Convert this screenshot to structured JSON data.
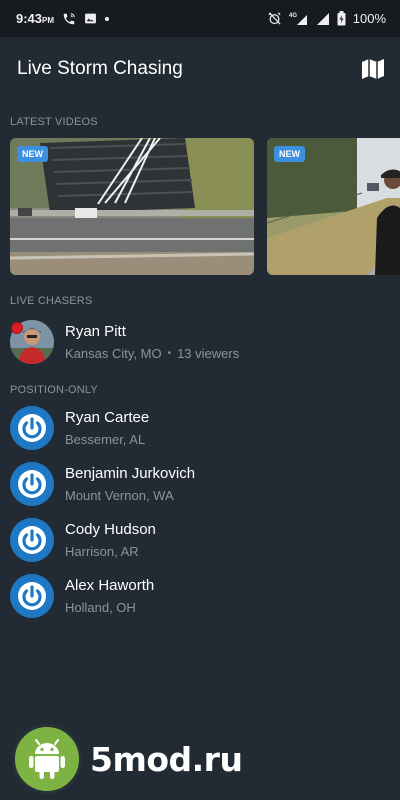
{
  "status_bar": {
    "time": "9:43",
    "time_suffix": "PM",
    "battery": "100%",
    "icons": [
      "phone-wifi-icon",
      "image-icon",
      "dot-icon",
      "alarm-off-icon",
      "lte-signal-icon",
      "signal-icon",
      "battery-icon"
    ]
  },
  "app_bar": {
    "title": "Live Storm Chasing",
    "action_icon": "map-icon"
  },
  "latest_videos": {
    "label": "LATEST VIDEOS",
    "items": [
      {
        "badge": "NEW"
      },
      {
        "badge": "NEW"
      }
    ]
  },
  "live_chasers": {
    "label": "LIVE CHASERS",
    "items": [
      {
        "name": "Ryan Pitt",
        "location": "Kansas City, MO",
        "separator": "•",
        "viewers": "13 viewers"
      }
    ]
  },
  "position_only": {
    "label": "POSITION-ONLY",
    "items": [
      {
        "name": "Ryan Cartee",
        "location": "Bessemer, AL"
      },
      {
        "name": "Benjamin Jurkovich",
        "location": "Mount Vernon, WA"
      },
      {
        "name": "Cody Hudson",
        "location": "Harrison, AR"
      },
      {
        "name": "Alex Haworth",
        "location": "Holland, OH"
      }
    ]
  },
  "watermark": {
    "text": "5mod.ru"
  },
  "colors": {
    "background": "#222a33",
    "status_bar": "#171b20",
    "accent_blue": "#1e78c3",
    "badge_blue": "#3d8fe0",
    "live_red": "#d81f26",
    "muted_text": "#8a949e"
  }
}
